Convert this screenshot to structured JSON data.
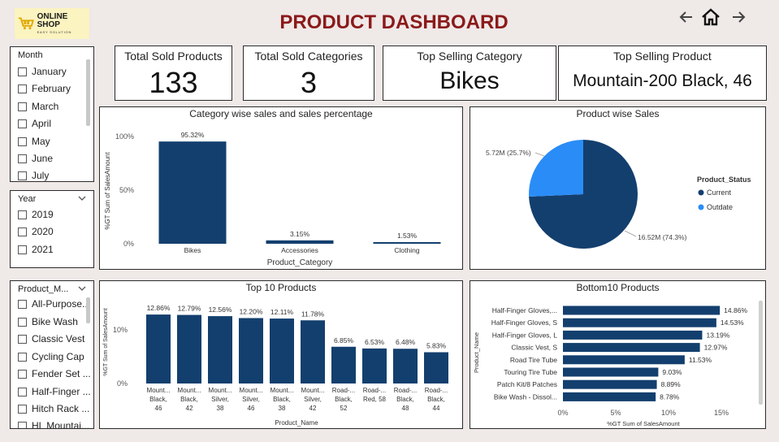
{
  "header": {
    "logo_main": "ONLINE SHOP",
    "logo_sub": "EASY SOLUTION",
    "title": "PRODUCT DASHBOARD"
  },
  "nav": {
    "back_icon": "arrow-left-icon",
    "home_icon": "home-icon",
    "forward_icon": "arrow-right-icon"
  },
  "kpis": [
    {
      "label": "Total Sold Products",
      "value": "133"
    },
    {
      "label": "Total Sold Categories",
      "value": "3"
    },
    {
      "label": "Top Selling Category",
      "value": "Bikes"
    },
    {
      "label": "Top Selling Product",
      "value": "Mountain-200 Black, 46"
    }
  ],
  "slicers": {
    "month": {
      "title": "Month",
      "items": [
        "January",
        "February",
        "March",
        "April",
        "May",
        "June",
        "July"
      ]
    },
    "year": {
      "title": "Year",
      "items": [
        "2019",
        "2020",
        "2021"
      ]
    },
    "product": {
      "title": "Product_M...",
      "items": [
        "All-Purpose...",
        "Bike Wash",
        "Classic Vest",
        "Cycling Cap",
        "Fender Set ...",
        "Half-Finger ...",
        "Hitch Rack ...",
        "HL Mountai..."
      ]
    }
  },
  "colors": {
    "bar": "#133f6e",
    "outdate": "#2a8cf7",
    "title": "#8b1a1a"
  },
  "chart_data": [
    {
      "type": "bar",
      "title": "Category wise sales and sales percentage",
      "xlabel": "Product_Category",
      "ylabel": "%GT Sum of SalesAmount",
      "categories": [
        "Bikes",
        "Accessories",
        "Clothing"
      ],
      "values": [
        95.32,
        3.15,
        1.53
      ],
      "value_labels": [
        "95.32%",
        "3.15%",
        "1.53%"
      ],
      "yticks": [
        "0%",
        "50%",
        "100%"
      ],
      "ylim": [
        0,
        100
      ]
    },
    {
      "type": "pie",
      "title": "Product wise Sales",
      "legend_title": "Product_Status",
      "legend_position": "right",
      "slices": [
        {
          "name": "Current",
          "value": 16.52,
          "label": "16.52M (74.3%)"
        },
        {
          "name": "Outdate",
          "value": 5.72,
          "label": "5.72M (25.7%)"
        }
      ]
    },
    {
      "type": "bar",
      "title": "Top 10 Products",
      "xlabel": "Product_Name",
      "ylabel": "%GT Sum of SalesAmount",
      "categories": [
        [
          "Mount...",
          "Black,",
          "46"
        ],
        [
          "Mount...",
          "Black,",
          "42"
        ],
        [
          "Mount...",
          "Silver,",
          "38"
        ],
        [
          "Mount...",
          "Silver,",
          "46"
        ],
        [
          "Mount...",
          "Black,",
          "38"
        ],
        [
          "Mount...",
          "Silver,",
          "42"
        ],
        [
          "Road-...",
          "Black,",
          "52"
        ],
        [
          "Road-...",
          "Red, 58"
        ],
        [
          "Road-...",
          "Black,",
          "48"
        ],
        [
          "Road-...",
          "Black,",
          "44"
        ]
      ],
      "values": [
        12.86,
        12.79,
        12.56,
        12.2,
        12.11,
        11.78,
        6.85,
        6.53,
        6.48,
        5.83
      ],
      "value_labels": [
        "12.86%",
        "12.79%",
        "12.56%",
        "12.20%",
        "12.11%",
        "11.78%",
        "6.85%",
        "6.53%",
        "6.48%",
        "5.83%"
      ],
      "yticks": [
        "0%",
        "10%"
      ],
      "ylim": [
        0,
        14.5
      ]
    },
    {
      "type": "bar",
      "orientation": "horizontal",
      "title": "Bottom10 Products",
      "xlabel": "%GT Sum of SalesAmount",
      "ylabel": "Product_Name",
      "categories": [
        "Half-Finger Gloves,...",
        "Half-Finger Gloves, S",
        "Half-Finger Gloves, L",
        "Classic Vest, S",
        "Road Tire Tube",
        "Touring Tire Tube",
        "Patch Kit/8 Patches",
        "Bike Wash - Dissol..."
      ],
      "values": [
        14.86,
        14.53,
        13.19,
        12.97,
        11.53,
        9.03,
        8.89,
        8.78
      ],
      "value_labels": [
        "14.86%",
        "14.53%",
        "13.19%",
        "12.97%",
        "11.53%",
        "9.03%",
        "8.89%",
        "8.78%"
      ],
      "xticks": [
        "0%",
        "5%",
        "10%",
        "15%"
      ],
      "xlim": [
        0,
        15
      ]
    }
  ]
}
